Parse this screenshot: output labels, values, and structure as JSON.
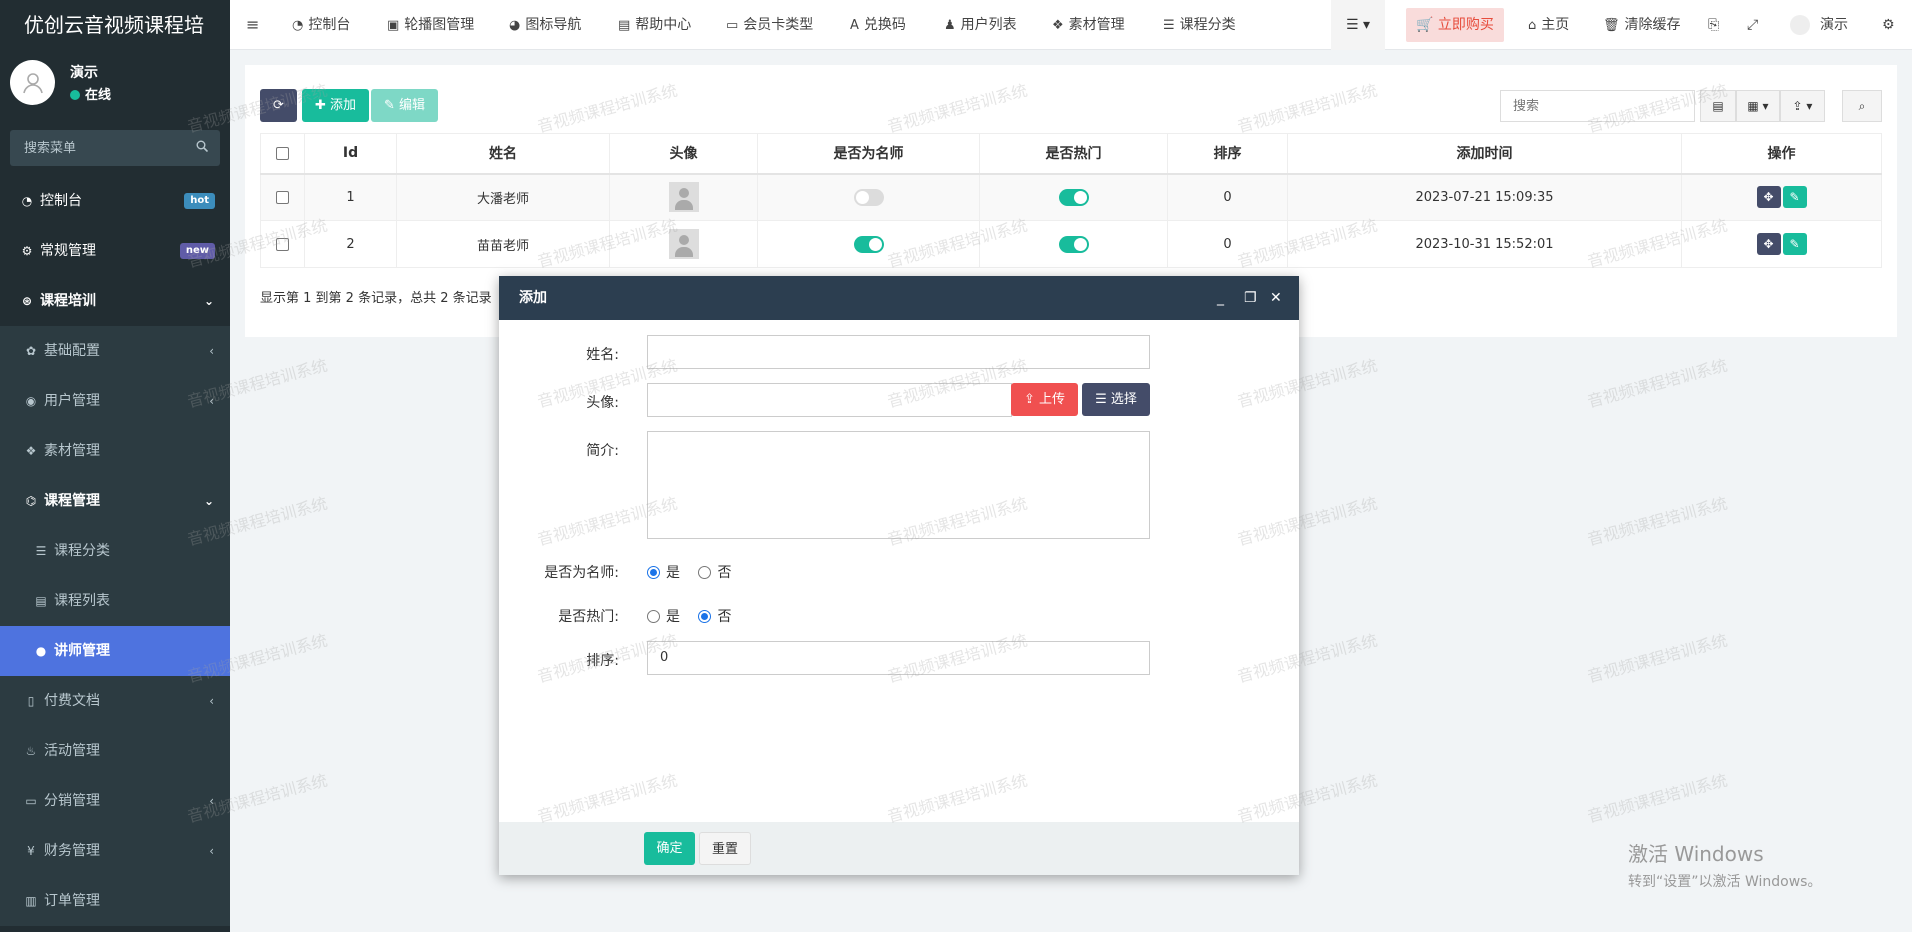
{
  "app": {
    "title": "优创云音视频课程培"
  },
  "user": {
    "name": "演示",
    "status": "在线"
  },
  "sidebar": {
    "search_placeholder": "搜索菜单",
    "items": [
      {
        "label": "控制台",
        "icon": "dashboard-icon",
        "badge": "hot"
      },
      {
        "label": "常规管理",
        "icon": "cogs-icon",
        "badge": "new"
      },
      {
        "label": "课程培训",
        "icon": "course-icon"
      },
      {
        "label": "基础配置",
        "icon": "gear-icon"
      },
      {
        "label": "用户管理",
        "icon": "user-circle-icon"
      },
      {
        "label": "素材管理",
        "icon": "cubes-icon"
      },
      {
        "label": "课程管理",
        "icon": "course-manage-icon"
      },
      {
        "label": "课程分类",
        "icon": "list-icon"
      },
      {
        "label": "课程列表",
        "icon": "list-alt-icon"
      },
      {
        "label": "讲师管理",
        "icon": "teacher-icon"
      },
      {
        "label": "付费文档",
        "icon": "file-icon"
      },
      {
        "label": "活动管理",
        "icon": "activity-icon"
      },
      {
        "label": "分销管理",
        "icon": "credit-card-icon"
      },
      {
        "label": "财务管理",
        "icon": "yen-icon"
      },
      {
        "label": "订单管理",
        "icon": "bar-chart-icon"
      }
    ]
  },
  "topnav": {
    "items": [
      {
        "label": "控制台",
        "icon": "dashboard-icon"
      },
      {
        "label": "轮播图管理",
        "icon": "image-icon"
      },
      {
        "label": "图标导航",
        "icon": "compass-icon"
      },
      {
        "label": "帮助中心",
        "icon": "file-text-icon"
      },
      {
        "label": "会员卡类型",
        "icon": "id-card-icon"
      },
      {
        "label": "兑换码",
        "icon": "font-icon"
      },
      {
        "label": "用户列表",
        "icon": "user-icon"
      },
      {
        "label": "素材管理",
        "icon": "cubes-icon"
      },
      {
        "label": "课程分类",
        "icon": "list-icon"
      }
    ],
    "buy": "立即购买",
    "home": "主页",
    "clear_cache": "清除缓存",
    "user": "演示"
  },
  "toolbar": {
    "add": "添加",
    "edit": "编辑",
    "search_placeholder": "搜索"
  },
  "table": {
    "columns": [
      "Id",
      "姓名",
      "头像",
      "是否为名师",
      "是否热门",
      "排序",
      "添加时间",
      "操作"
    ],
    "rows": [
      {
        "id": "1",
        "name": "大潘老师",
        "is_famous": false,
        "is_hot": true,
        "sort": "0",
        "time": "2023-07-21 15:09:35"
      },
      {
        "id": "2",
        "name": "苗苗老师",
        "is_famous": true,
        "is_hot": true,
        "sort": "0",
        "time": "2023-10-31 15:52:01"
      }
    ],
    "page_info": "显示第 1 到第 2 条记录，总共 2 条记录"
  },
  "modal": {
    "title": "添加",
    "fields": {
      "name_label": "姓名:",
      "avatar_label": "头像:",
      "intro_label": "简介:",
      "famous_label": "是否为名师:",
      "hot_label": "是否热门:",
      "sort_label": "排序:",
      "sort_value": "0",
      "upload": "上传",
      "choose": "选择",
      "yes": "是",
      "no": "否"
    },
    "confirm": "确定",
    "reset": "重置"
  },
  "watermark": "音视频课程培训系统",
  "windows": {
    "line1": "激活 Windows",
    "line2": "转到“设置”以激活 Windows。"
  },
  "colors": {
    "sidebar": "#222d32",
    "accent": "#18bc9c",
    "active": "#4e73df",
    "header": "#2c3e50"
  }
}
